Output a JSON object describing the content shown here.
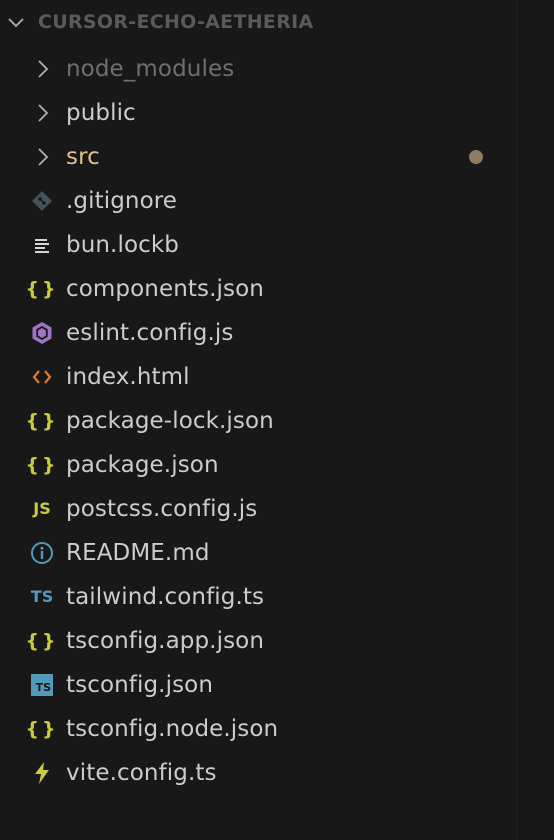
{
  "explorer": {
    "section_title": "CURSOR-ECHO-AETHERIA",
    "items": [
      {
        "label": "node_modules",
        "icon": "chevron-right-icon",
        "kind": "folder",
        "state": "ignored"
      },
      {
        "label": "public",
        "icon": "chevron-right-icon",
        "kind": "folder",
        "state": "normal"
      },
      {
        "label": "src",
        "icon": "chevron-right-icon",
        "kind": "folder",
        "state": "modified"
      },
      {
        "label": ".gitignore",
        "icon": "git-icon",
        "kind": "file"
      },
      {
        "label": "bun.lockb",
        "icon": "lines-icon",
        "kind": "file"
      },
      {
        "label": "components.json",
        "icon": "json-braces-icon",
        "icon_text": "{}",
        "kind": "file"
      },
      {
        "label": "eslint.config.js",
        "icon": "eslint-icon",
        "kind": "file"
      },
      {
        "label": "index.html",
        "icon": "html-icon",
        "kind": "file"
      },
      {
        "label": "package-lock.json",
        "icon": "json-braces-icon",
        "icon_text": "{}",
        "kind": "file"
      },
      {
        "label": "package.json",
        "icon": "json-braces-icon",
        "icon_text": "{}",
        "kind": "file"
      },
      {
        "label": "postcss.config.js",
        "icon": "javascript-icon",
        "icon_text": "JS",
        "kind": "file"
      },
      {
        "label": "README.md",
        "icon": "info-icon",
        "kind": "file"
      },
      {
        "label": "tailwind.config.ts",
        "icon": "typescript-icon",
        "icon_text": "TS",
        "kind": "file"
      },
      {
        "label": "tsconfig.app.json",
        "icon": "json-braces-icon",
        "icon_text": "{}",
        "kind": "file"
      },
      {
        "label": "tsconfig.json",
        "icon": "tsconfig-icon",
        "icon_text": "TS",
        "kind": "file"
      },
      {
        "label": "tsconfig.node.json",
        "icon": "json-braces-icon",
        "icon_text": "{}",
        "kind": "file"
      },
      {
        "label": "vite.config.ts",
        "icon": "vite-bolt-icon",
        "kind": "file"
      }
    ]
  },
  "colors": {
    "background": "#181818",
    "text": "#cccccc",
    "ignored_text": "#6f6f6f",
    "modified_text": "#e2c08d",
    "modified_dot": "#8d7c5e",
    "json_yellow": "#cbcb41",
    "ts_blue": "#519aba",
    "html_orange": "#e37933",
    "eslint_purple": "#a074c4",
    "git_gray": "#41535b"
  }
}
